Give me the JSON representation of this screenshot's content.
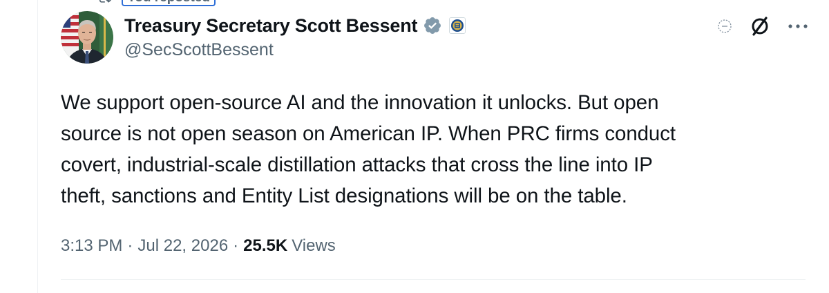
{
  "repost": {
    "label": "You reposted"
  },
  "author": {
    "display_name": "Treasury Secretary Scott Bessent",
    "handle": "@SecScottBessent",
    "verified_icon": "verified-badge-icon",
    "affiliate_icon": "treasury-seal-icon"
  },
  "actions": {
    "grok_icon": "grok-icon",
    "slash_icon": "slashed-circle-icon",
    "more_icon": "more-horizontal-icon"
  },
  "tweet": {
    "text": "We support open-source AI and the innovation it unlocks. But open\nsource is not open season on American IP. When PRC firms conduct\ncovert, industrial-scale distillation attacks that cross the line into IP\ntheft, sanctions and Entity List designations will be on the table."
  },
  "meta": {
    "time": "3:13 PM",
    "separator": "·",
    "date": "Jul 22, 2026",
    "views_count": "25.5K",
    "views_label": "Views"
  },
  "colors": {
    "text_primary": "#0f1419",
    "text_secondary": "#536471",
    "verified_gray": "#829aab",
    "highlight_blue": "#2f6fd8"
  }
}
